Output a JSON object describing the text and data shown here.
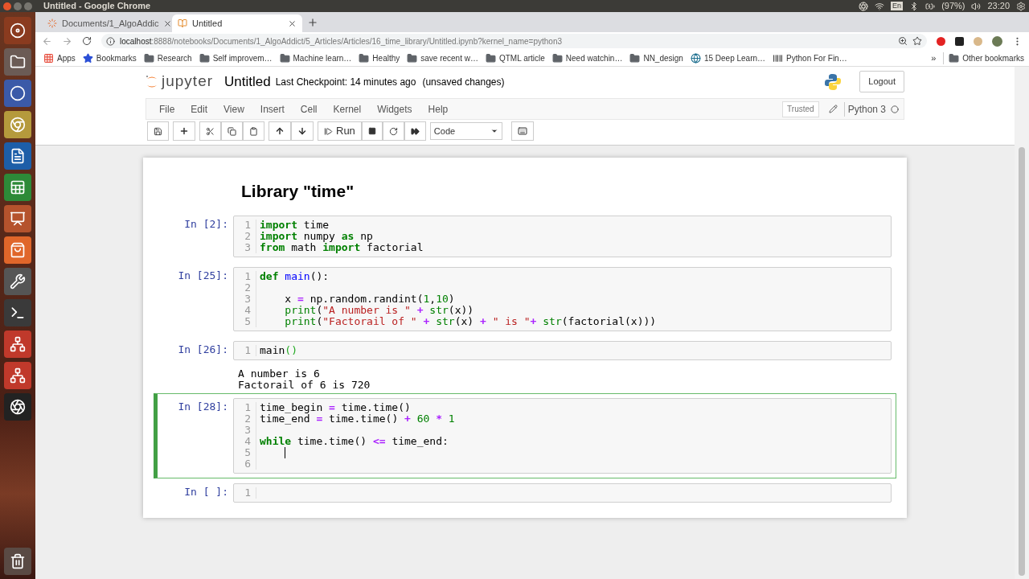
{
  "system_bar": {
    "title": "Untitled - Google Chrome",
    "keyboard": "En",
    "battery": "(97%)",
    "clock": "23:20"
  },
  "browser": {
    "tabs": [
      {
        "title": "Documents/1_AlgoAddic",
        "selected": false
      },
      {
        "title": "Untitled",
        "selected": true
      }
    ],
    "url_host": "localhost",
    "url_rest": ":8888/notebooks/Documents/1_AlgoAddict/5_Articles/Articles/16_time_library/Untitled.ipynb?kernel_name=python3",
    "bookmarks": [
      {
        "label": "Apps",
        "kind": "apps"
      },
      {
        "label": "Bookmarks",
        "kind": "star"
      },
      {
        "label": "Research",
        "kind": "folder"
      },
      {
        "label": "Self improvem…",
        "kind": "folder"
      },
      {
        "label": "Machine learn…",
        "kind": "folder"
      },
      {
        "label": "Healthy",
        "kind": "folder"
      },
      {
        "label": "save recent w…",
        "kind": "folder"
      },
      {
        "label": "QTML article",
        "kind": "folder"
      },
      {
        "label": "Need watchin…",
        "kind": "folder"
      },
      {
        "label": "NN_design",
        "kind": "folder"
      },
      {
        "label": "15 Deep Learn…",
        "kind": "globe"
      },
      {
        "label": "Python For Fin…",
        "kind": "barcode"
      }
    ],
    "overflow": "»",
    "other_bookmarks": "Other bookmarks"
  },
  "jupyter": {
    "logo_text": "jupyter",
    "notebook_name": "Untitled",
    "checkpoint": "Last Checkpoint: 14 minutes ago",
    "unsaved": "(unsaved changes)",
    "logout": "Logout",
    "menu": [
      "File",
      "Edit",
      "View",
      "Insert",
      "Cell",
      "Kernel",
      "Widgets",
      "Help"
    ],
    "trusted": "Trusted",
    "kernel": "Python 3",
    "run": "Run",
    "cell_type": "Code"
  },
  "cells": [
    {
      "kind": "markdown",
      "text": "Library \"time\""
    },
    {
      "kind": "code",
      "prompt": "In [2]:",
      "selected": false,
      "lines": [
        {
          "n": "1",
          "tokens": [
            {
              "t": "import ",
              "kind": "kw"
            },
            {
              "t": "time",
              "kind": "p"
            }
          ]
        },
        {
          "n": "2",
          "tokens": [
            {
              "t": "import ",
              "kind": "kw"
            },
            {
              "t": "numpy ",
              "kind": "p"
            },
            {
              "t": "as ",
              "kind": "kw"
            },
            {
              "t": "np",
              "kind": "p"
            }
          ]
        },
        {
          "n": "3",
          "tokens": [
            {
              "t": "from ",
              "kind": "kw"
            },
            {
              "t": "math ",
              "kind": "p"
            },
            {
              "t": "import ",
              "kind": "kw"
            },
            {
              "t": "factorial",
              "kind": "p"
            }
          ]
        }
      ]
    },
    {
      "kind": "code",
      "prompt": "In [25]:",
      "selected": false,
      "lines": [
        {
          "n": "1",
          "tokens": [
            {
              "t": "def ",
              "kind": "kw"
            },
            {
              "t": "main",
              "kind": "def"
            },
            {
              "t": "():",
              "kind": "p"
            }
          ]
        },
        {
          "n": "2"
        },
        {
          "n": "3",
          "tokens": [
            {
              "t": "    x ",
              "kind": "p"
            },
            {
              "t": "= ",
              "kind": "op"
            },
            {
              "t": "np.random.randint(",
              "kind": "p"
            },
            {
              "t": "1",
              "kind": "num"
            },
            {
              "t": ",",
              "kind": "p"
            },
            {
              "t": "10",
              "kind": "num"
            },
            {
              "t": ")",
              "kind": "p"
            }
          ]
        },
        {
          "n": "4",
          "tokens": [
            {
              "t": "    print",
              "kind": "builtin"
            },
            {
              "t": "(",
              "kind": "p"
            },
            {
              "t": "\"A number is \" ",
              "kind": "str"
            },
            {
              "t": "+ ",
              "kind": "op"
            },
            {
              "t": "str",
              "kind": "builtin"
            },
            {
              "t": "(x))",
              "kind": "p"
            }
          ]
        },
        {
          "n": "5",
          "tokens": [
            {
              "t": "    print",
              "kind": "builtin"
            },
            {
              "t": "(",
              "kind": "p"
            },
            {
              "t": "\"Factorail of \" ",
              "kind": "str"
            },
            {
              "t": "+ ",
              "kind": "op"
            },
            {
              "t": "str",
              "kind": "builtin"
            },
            {
              "t": "(x) ",
              "kind": "p"
            },
            {
              "t": "+ ",
              "kind": "op"
            },
            {
              "t": "\" is \"",
              "kind": "str"
            },
            {
              "t": "+ ",
              "kind": "op"
            },
            {
              "t": "str",
              "kind": "builtin"
            },
            {
              "t": "(factorial(x)))",
              "kind": "p"
            }
          ]
        }
      ]
    },
    {
      "kind": "code",
      "prompt": "In [26]:",
      "selected": false,
      "lines": [
        {
          "n": "1",
          "tokens": [
            {
              "t": "main",
              "kind": "p"
            },
            {
              "t": "()",
              "kind": "match"
            }
          ]
        }
      ],
      "output": [
        "A number is 6",
        "Factorail of 6 is 720"
      ]
    },
    {
      "kind": "code",
      "prompt": "In [28]:",
      "selected": true,
      "lines": [
        {
          "n": "1",
          "tokens": [
            {
              "t": "time_begin ",
              "kind": "p"
            },
            {
              "t": "= ",
              "kind": "op"
            },
            {
              "t": "time.time()",
              "kind": "p"
            }
          ]
        },
        {
          "n": "2",
          "tokens": [
            {
              "t": "time_end ",
              "kind": "p"
            },
            {
              "t": "= ",
              "kind": "op"
            },
            {
              "t": "time.time() ",
              "kind": "p"
            },
            {
              "t": "+ ",
              "kind": "op"
            },
            {
              "t": "60 ",
              "kind": "num"
            },
            {
              "t": "* ",
              "kind": "op"
            },
            {
              "t": "1",
              "kind": "num"
            }
          ]
        },
        {
          "n": "3"
        },
        {
          "n": "4",
          "tokens": [
            {
              "t": "while ",
              "kind": "kw"
            },
            {
              "t": "time.time() ",
              "kind": "p"
            },
            {
              "t": "<= ",
              "kind": "op"
            },
            {
              "t": "time_end:",
              "kind": "p"
            }
          ]
        },
        {
          "n": "5",
          "tokens": [
            {
              "kind": "cursor"
            }
          ]
        },
        {
          "n": "6"
        }
      ]
    },
    {
      "kind": "code",
      "prompt": "In [ ]:",
      "selected": false,
      "lines": [
        {
          "n": "1"
        }
      ]
    }
  ]
}
